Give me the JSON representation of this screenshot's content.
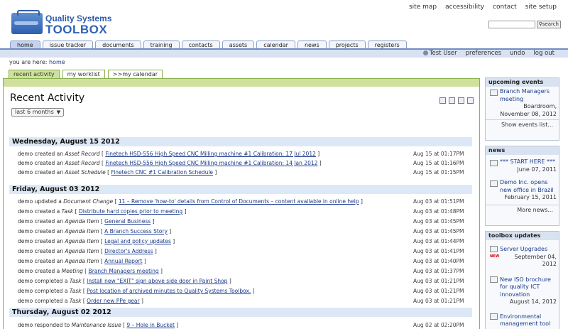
{
  "header": {
    "logo_line1": "Quality Systems",
    "logo_line2": "TOOLBOX",
    "util_links": [
      "site map",
      "accessibility",
      "contact",
      "site setup"
    ],
    "search_button": "search"
  },
  "tabs": [
    "home",
    "issue tracker",
    "documents",
    "training",
    "contacts",
    "assets",
    "calendar",
    "news",
    "projects",
    "registers"
  ],
  "active_tab": "home",
  "userbar": {
    "user": "Test User",
    "links": [
      "preferences",
      "undo",
      "log out"
    ]
  },
  "breadcrumb": {
    "prefix": "you are here:",
    "current": "home"
  },
  "subtabs": [
    "recent activity",
    "my worklist",
    ">>my calendar"
  ],
  "main": {
    "title": "Recent Activity",
    "range": "last 6 months"
  },
  "days": [
    {
      "heading": "Wednesday, August 15 2012",
      "rows": [
        {
          "prefix": "demo created an",
          "kind": "Asset Record",
          "link": "Finetech HSD-556 High Speed CNC Milling machine #1 Calibration: 17 Jul 2012",
          "time": "Aug 15 at 01:17PM"
        },
        {
          "prefix": "demo created an",
          "kind": "Asset Record",
          "link": "Finetech HSD-556 High Speed CNC Milling machine #1 Calibration: 14 Jan 2012",
          "time": "Aug 15 at 01:16PM"
        },
        {
          "prefix": "demo created an",
          "kind": "Asset Schedule",
          "link": "Finetech CNC #1 Calibration Schedule",
          "time": "Aug 15 at 01:15PM"
        }
      ]
    },
    {
      "heading": "Friday, August 03 2012",
      "rows": [
        {
          "prefix": "demo updated a",
          "kind": "Document Change",
          "link": "11 – Remove 'how-to' details from Control of Documents – content available in online help",
          "time": "Aug 03 at 01:51PM"
        },
        {
          "prefix": "demo created a",
          "kind": "Task",
          "link": "Distribute hard copies prior to meeting",
          "time": "Aug 03 at 01:48PM"
        },
        {
          "prefix": "demo created an",
          "kind": "Agenda Item",
          "link": "General Business",
          "time": "Aug 03 at 01:45PM"
        },
        {
          "prefix": "demo created an",
          "kind": "Agenda Item",
          "link": "A Branch Success Story",
          "time": "Aug 03 at 01:45PM"
        },
        {
          "prefix": "demo created an",
          "kind": "Agenda Item",
          "link": "Legal and policy updates",
          "time": "Aug 03 at 01:44PM"
        },
        {
          "prefix": "demo created an",
          "kind": "Agenda Item",
          "link": "Director's Address",
          "time": "Aug 03 at 01:41PM"
        },
        {
          "prefix": "demo created an",
          "kind": "Agenda Item",
          "link": "Annual Report",
          "time": "Aug 03 at 01:40PM"
        },
        {
          "prefix": "demo created a",
          "kind": "Meeting",
          "link": "Branch Managers meeting",
          "time": "Aug 03 at 01:37PM"
        },
        {
          "prefix": "demo completed a",
          "kind": "Task",
          "link": "Install new \"EXIT\" sign above side door in Paint Shop",
          "time": "Aug 03 at 01:21PM"
        },
        {
          "prefix": "demo completed a",
          "kind": "Task",
          "link": "Post location of archived minutes to Quality Systems Toolbox.",
          "time": "Aug 03 at 01:21PM"
        },
        {
          "prefix": "demo completed a",
          "kind": "Task",
          "link": "Order new PPe gear",
          "time": "Aug 03 at 01:21PM"
        }
      ]
    },
    {
      "heading": "Thursday, August 02 2012",
      "rows": [
        {
          "prefix": "demo responded to",
          "kind": "Maintenance Issue",
          "link": "9 – Hole in Bucket",
          "time": "Aug 02 at 02:20PM"
        }
      ]
    }
  ],
  "sidebar": {
    "upcoming": {
      "title": "upcoming events",
      "item": "Branch Managers meeting",
      "place": "Boardroom,",
      "date": "November 08, 2012",
      "more": "Show events list..."
    },
    "news": {
      "title": "news",
      "items": [
        {
          "text": "*** START HERE ***",
          "date": "June 07, 2011"
        },
        {
          "text": "Demo Inc. opens new office in Brazil",
          "date": "February 15, 2011"
        }
      ],
      "more": "More news..."
    },
    "updates": {
      "title": "toolbox updates",
      "badge": "NEW",
      "items": [
        {
          "text": "Server Upgrades",
          "date": "September 04, 2012"
        },
        {
          "text": "New ISO brochure for quality ICT innovation",
          "date": "August 14, 2012"
        },
        {
          "text": "Environmental management tool from"
        }
      ]
    }
  }
}
